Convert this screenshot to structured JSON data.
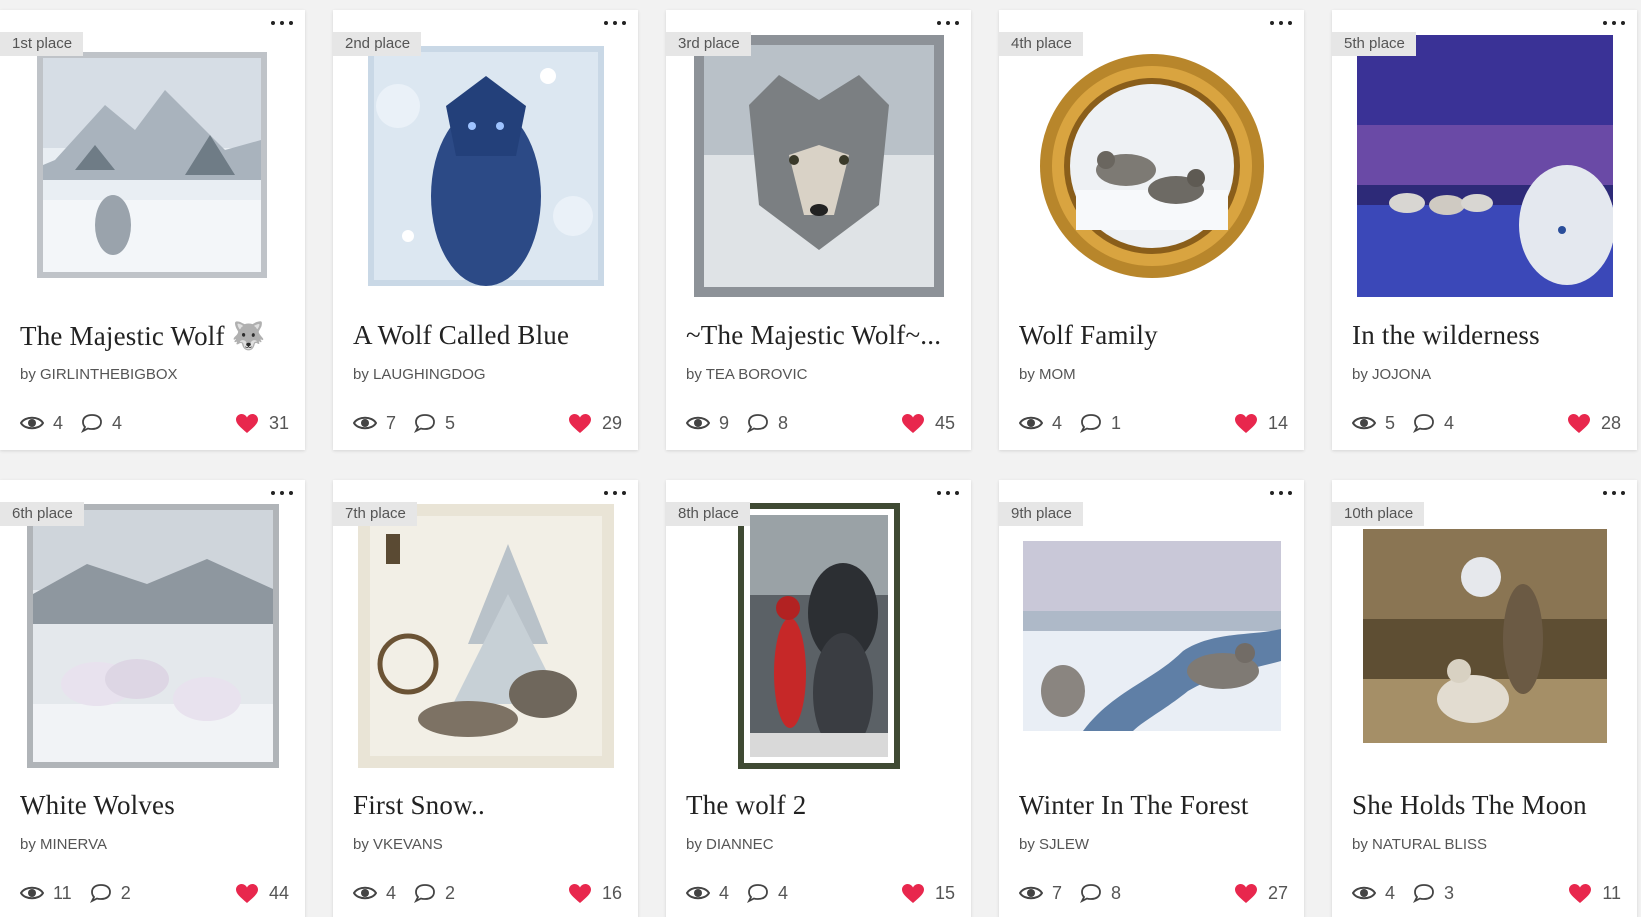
{
  "colors": {
    "heart": "#e8274d",
    "badge_bg": "#e6e6e6",
    "page_bg": "#f2f2f2"
  },
  "byline_prefix": "by",
  "cards": [
    {
      "rank": "1st place",
      "title": "The Majestic Wolf 🐺",
      "author": "GIRLINTHEBIGBOX",
      "views": "4",
      "comments": "4",
      "likes": "31"
    },
    {
      "rank": "2nd place",
      "title": "A Wolf Called Blue",
      "author": "LAUGHINGDOG",
      "views": "7",
      "comments": "5",
      "likes": "29"
    },
    {
      "rank": "3rd place",
      "title": "~The Majestic Wolf~...",
      "author": "TEA BOROVIC",
      "views": "9",
      "comments": "8",
      "likes": "45"
    },
    {
      "rank": "4th place",
      "title": "Wolf Family",
      "author": "MOM",
      "views": "4",
      "comments": "1",
      "likes": "14"
    },
    {
      "rank": "5th place",
      "title": "In the wilderness",
      "author": "JOJONA",
      "views": "5",
      "comments": "4",
      "likes": "28"
    },
    {
      "rank": "6th place",
      "title": "White Wolves",
      "author": "MINERVA",
      "views": "11",
      "comments": "2",
      "likes": "44"
    },
    {
      "rank": "7th place",
      "title": "First Snow..",
      "author": "VKEVANS",
      "views": "4",
      "comments": "2",
      "likes": "16"
    },
    {
      "rank": "8th place",
      "title": "The wolf 2",
      "author": "DIANNEC",
      "views": "4",
      "comments": "4",
      "likes": "15"
    },
    {
      "rank": "9th place",
      "title": "Winter In The Forest",
      "author": "SJLEW",
      "views": "7",
      "comments": "8",
      "likes": "27"
    },
    {
      "rank": "10th place",
      "title": "She Holds The Moon",
      "author": "NATURAL BLISS",
      "views": "4",
      "comments": "3",
      "likes": "11"
    }
  ],
  "icons": {
    "views": "eye-icon",
    "comments": "comment-icon",
    "likes": "heart-icon",
    "more": "more-dots-icon"
  }
}
